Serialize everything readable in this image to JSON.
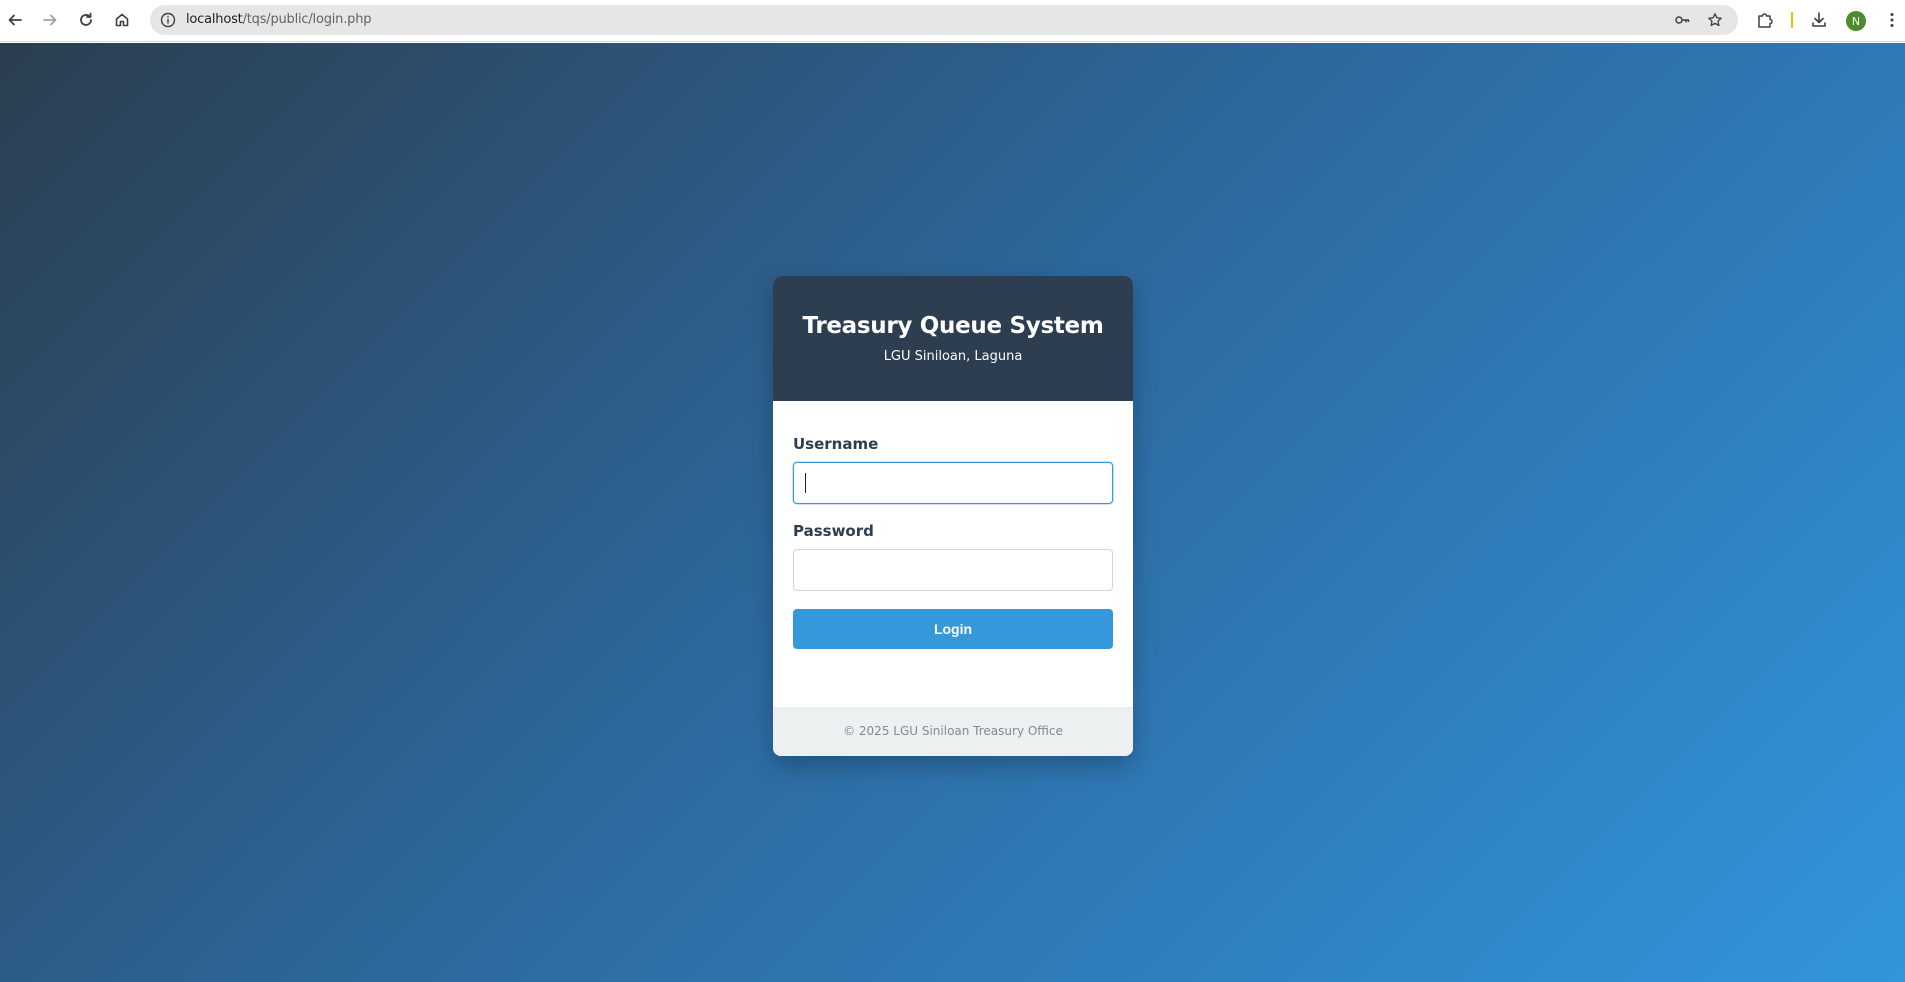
{
  "browser": {
    "url_host": "localhost",
    "url_path": "/tqs/public/login.php",
    "profile_initial": "N"
  },
  "login_card": {
    "title": "Treasury Queue System",
    "subtitle": "LGU Siniloan, Laguna",
    "username_label": "Username",
    "username_value": "",
    "password_label": "Password",
    "password_value": "",
    "login_button": "Login",
    "footer": "© 2025 LGU Siniloan Treasury Office"
  },
  "colors": {
    "header_bg": "#2c3e50",
    "button_bg": "#3498db",
    "footer_bg": "#ecf0f1",
    "gradient_start": "#2c3e50",
    "gradient_end": "#3296dc"
  },
  "icons": {
    "back": "arrow-left",
    "forward": "arrow-right",
    "reload": "refresh",
    "home": "house",
    "site_info": "info-circle",
    "password_manager": "key",
    "bookmark": "star",
    "extensions": "puzzle",
    "downloads": "download",
    "menu": "three-dots-vertical"
  }
}
